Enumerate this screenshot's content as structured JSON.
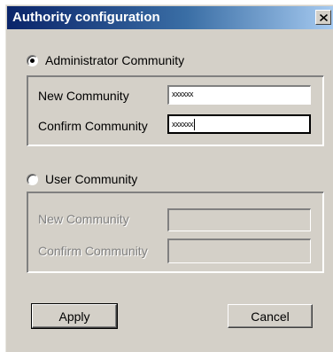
{
  "window": {
    "title": "Authority configuration",
    "close_glyph": "✕"
  },
  "admin": {
    "radio_label": "Administrator Community",
    "selected": true,
    "new_label": "New Community",
    "new_value": "xxxxxx",
    "confirm_label": "Confirm Community",
    "confirm_value": "xxxxxx"
  },
  "user": {
    "radio_label": "User Community",
    "selected": false,
    "new_label": "New Community",
    "new_value": "",
    "confirm_label": "Confirm Community",
    "confirm_value": ""
  },
  "buttons": {
    "apply_label": "Apply",
    "cancel_label": "Cancel"
  },
  "colors": {
    "dialog_face": "#d4d0c8",
    "titlebar_start": "#0a246a",
    "titlebar_end": "#a6caf0",
    "disabled_text": "#808080"
  },
  "icons": [
    "close-icon",
    "radio-checked-icon",
    "radio-unchecked-icon"
  ]
}
